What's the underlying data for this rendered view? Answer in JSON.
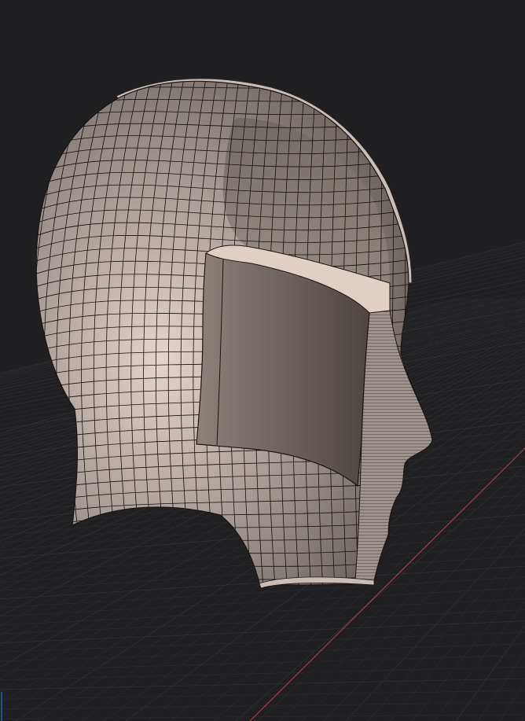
{
  "viewport": {
    "background_color": "#1f1f21",
    "grid_color": "#2b2b2e",
    "grid_major_color": "#323236",
    "axis_x_color": "#a13a3f",
    "axis_y_color": "#2e5fa8"
  },
  "model": {
    "icon": "head-mesh-icon",
    "surface_color": "#9a8f8a",
    "shell_edge_color": "#c9bdb6",
    "cut_face_color": "#9c918b",
    "mesh_line_color": "#111111",
    "inner_body_color": "#6e635e",
    "inner_body_top_color": "#e2cfc4"
  }
}
